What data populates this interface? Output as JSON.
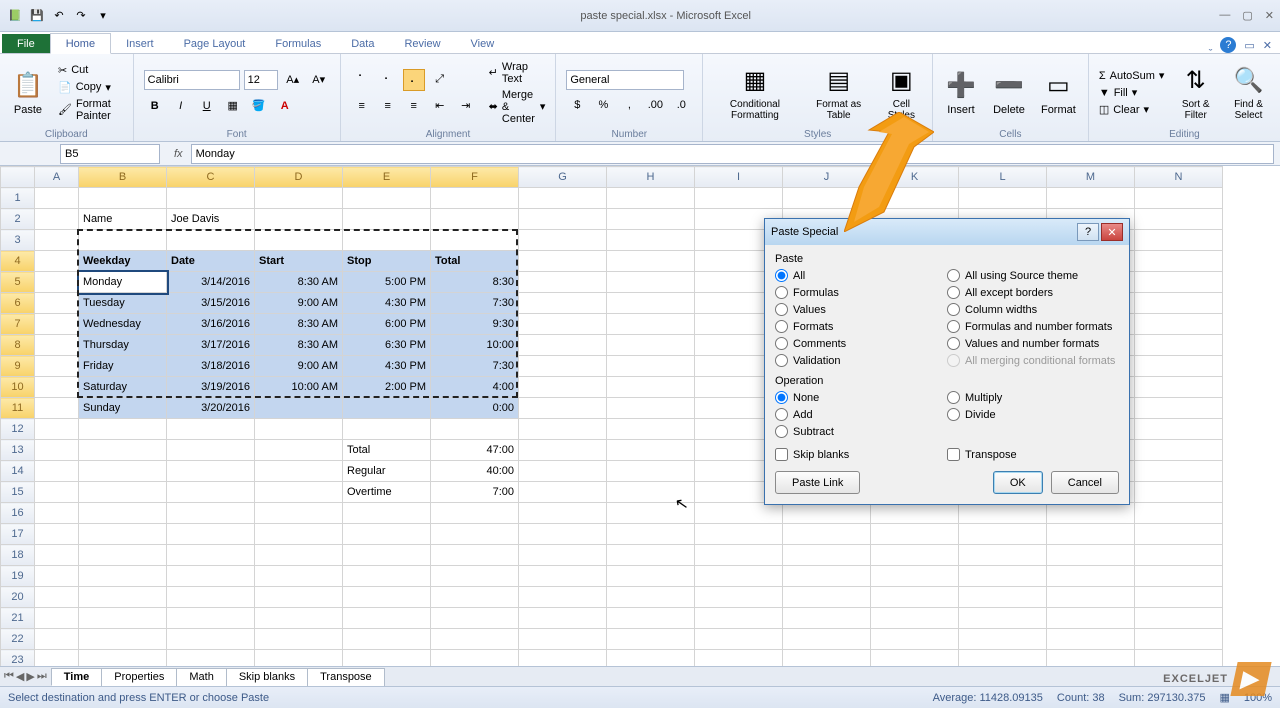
{
  "window": {
    "title": "paste special.xlsx - Microsoft Excel"
  },
  "tabs": {
    "file": "File",
    "home": "Home",
    "insert": "Insert",
    "page": "Page Layout",
    "formulas": "Formulas",
    "data": "Data",
    "review": "Review",
    "view": "View"
  },
  "ribbon": {
    "clipboard": {
      "name": "Clipboard",
      "paste": "Paste",
      "cut": "Cut",
      "copy": "Copy",
      "painter": "Format Painter"
    },
    "font": {
      "name": "Font",
      "family": "Calibri",
      "size": "12"
    },
    "alignment": {
      "name": "Alignment",
      "wrap": "Wrap Text",
      "merge": "Merge & Center"
    },
    "number": {
      "name": "Number",
      "format": "General"
    },
    "styles": {
      "name": "Styles",
      "cond": "Conditional Formatting",
      "table": "Format as Table",
      "cell": "Cell Styles"
    },
    "cells": {
      "name": "Cells",
      "insert": "Insert",
      "delete": "Delete",
      "format": "Format"
    },
    "editing": {
      "name": "Editing",
      "autosum": "AutoSum",
      "fill": "Fill",
      "clear": "Clear",
      "sort": "Sort & Filter",
      "find": "Find & Select"
    }
  },
  "namebox": "B5",
  "formula": "Monday",
  "columns": [
    "",
    "A",
    "B",
    "C",
    "D",
    "E",
    "F",
    "G",
    "H",
    "I",
    "J",
    "K",
    "L",
    "M",
    "N"
  ],
  "labels": {
    "name": "Name",
    "person": "Joe Davis",
    "weekday": "Weekday",
    "date": "Date",
    "start": "Start",
    "stop": "Stop",
    "total": "Total",
    "totalL": "Total",
    "regular": "Regular",
    "overtime": "Overtime"
  },
  "table": [
    {
      "wd": "Monday",
      "d": "3/14/2016",
      "s": "8:30 AM",
      "e": "5:00 PM",
      "t": "8:30"
    },
    {
      "wd": "Tuesday",
      "d": "3/15/2016",
      "s": "9:00 AM",
      "e": "4:30 PM",
      "t": "7:30"
    },
    {
      "wd": "Wednesday",
      "d": "3/16/2016",
      "s": "8:30 AM",
      "e": "6:00 PM",
      "t": "9:30"
    },
    {
      "wd": "Thursday",
      "d": "3/17/2016",
      "s": "8:30 AM",
      "e": "6:30 PM",
      "t": "10:00"
    },
    {
      "wd": "Friday",
      "d": "3/18/2016",
      "s": "9:00 AM",
      "e": "4:30 PM",
      "t": "7:30"
    },
    {
      "wd": "Saturday",
      "d": "3/19/2016",
      "s": "10:00 AM",
      "e": "2:00 PM",
      "t": "4:00"
    },
    {
      "wd": "Sunday",
      "d": "3/20/2016",
      "s": "",
      "e": "",
      "t": "0:00"
    }
  ],
  "summary": {
    "total": "47:00",
    "regular": "40:00",
    "overtime": "7:00"
  },
  "sheets": [
    "Time",
    "Properties",
    "Math",
    "Skip blanks",
    "Transpose"
  ],
  "status": {
    "msg": "Select destination and press ENTER or choose Paste",
    "avg": "Average: 11428.09135",
    "count": "Count: 38",
    "sum": "Sum: 297130.375",
    "zoom": "100%"
  },
  "dialog": {
    "title": "Paste Special",
    "pasteLabel": "Paste",
    "opLabel": "Operation",
    "opts1": [
      "All",
      "Formulas",
      "Values",
      "Formats",
      "Comments",
      "Validation"
    ],
    "opts2": [
      "All using Source theme",
      "All except borders",
      "Column widths",
      "Formulas and number formats",
      "Values and number formats",
      "All merging conditional formats"
    ],
    "ops1": [
      "None",
      "Add",
      "Subtract"
    ],
    "ops2": [
      "Multiply",
      "Divide"
    ],
    "skip": "Skip blanks",
    "transpose": "Transpose",
    "pastelink": "Paste Link",
    "ok": "OK",
    "cancel": "Cancel"
  },
  "watermark": "EXCELJET"
}
